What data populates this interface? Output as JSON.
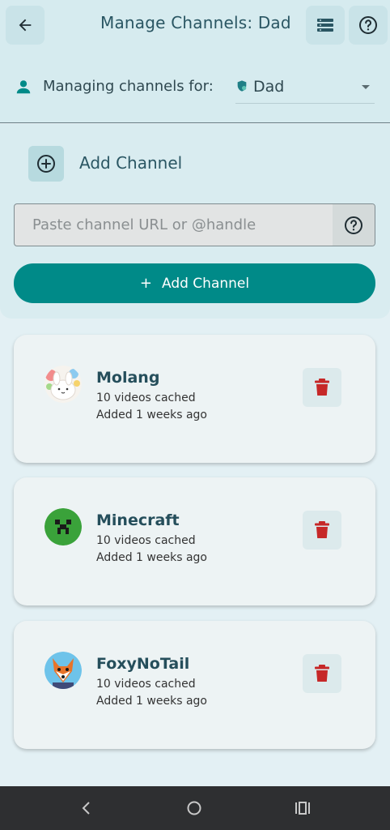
{
  "topbar": {
    "title": "Manage Channels: Dad",
    "back_icon": "arrow-left-icon",
    "list_icon": "list-icon",
    "help_icon": "help-circle-icon"
  },
  "manage": {
    "label": "Managing channels for:",
    "selected_profile": "Dad"
  },
  "add_panel": {
    "heading": "Add Channel",
    "input_placeholder": "Paste channel URL or @handle",
    "input_value": "",
    "button_label": "Add Channel",
    "button_plus": "+"
  },
  "channels": [
    {
      "name": "Molang",
      "count": "10 videos cached",
      "added": "Added 1 weeks ago",
      "avatar": "molang-avatar"
    },
    {
      "name": "Minecraft",
      "count": "10 videos cached",
      "added": "Added 1 weeks ago",
      "avatar": "minecraft-avatar"
    },
    {
      "name": "FoxyNoTail",
      "count": "10 videos cached",
      "added": "Added 1 weeks ago",
      "avatar": "fox-avatar"
    }
  ],
  "colors": {
    "accent": "#008a88",
    "delete": "#c62828",
    "background": "#e3f0f4",
    "navbar": "#2e2f31"
  }
}
